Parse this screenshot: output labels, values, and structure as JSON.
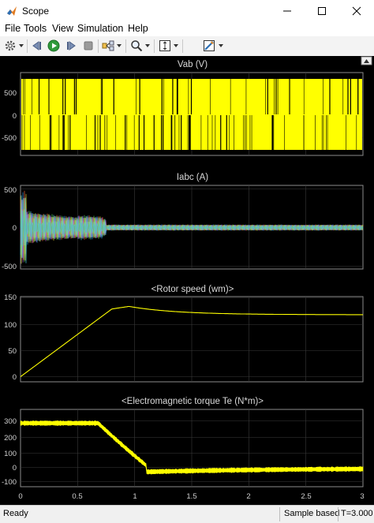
{
  "window": {
    "title": "Scope"
  },
  "menu": [
    "File",
    "Tools",
    "View",
    "Simulation",
    "Help"
  ],
  "toolbar": {
    "icons": [
      "settings-icon",
      "step-back-icon",
      "run-icon",
      "step-forward-icon",
      "stop-icon",
      "highlight-block-icon",
      "zoom-icon",
      "autoscale-icon",
      "style-icon"
    ]
  },
  "plots": [
    {
      "title": "Vab (V)",
      "yticks": [
        "500",
        "0",
        "-500"
      ]
    },
    {
      "title": "Iabc (A)",
      "yticks": [
        "500",
        "0",
        "-500"
      ]
    },
    {
      "title": "<Rotor speed (wm)>",
      "yticks": [
        "150",
        "100",
        "50",
        "0"
      ]
    },
    {
      "title": "<Electromagnetic torque Te (N*m)>",
      "yticks": [
        "300",
        "200",
        "100",
        "0",
        "-100"
      ]
    }
  ],
  "xticks": [
    "0",
    "0.5",
    "1",
    "1.5",
    "2",
    "2.5",
    "3"
  ],
  "status": {
    "left": "Ready",
    "mode": "Sample based",
    "time": "T=3.000"
  },
  "colors": {
    "background": "#000000",
    "axes": "#8c8c8c",
    "signal": "#ffff00",
    "grid": "#3a3a3a"
  }
}
